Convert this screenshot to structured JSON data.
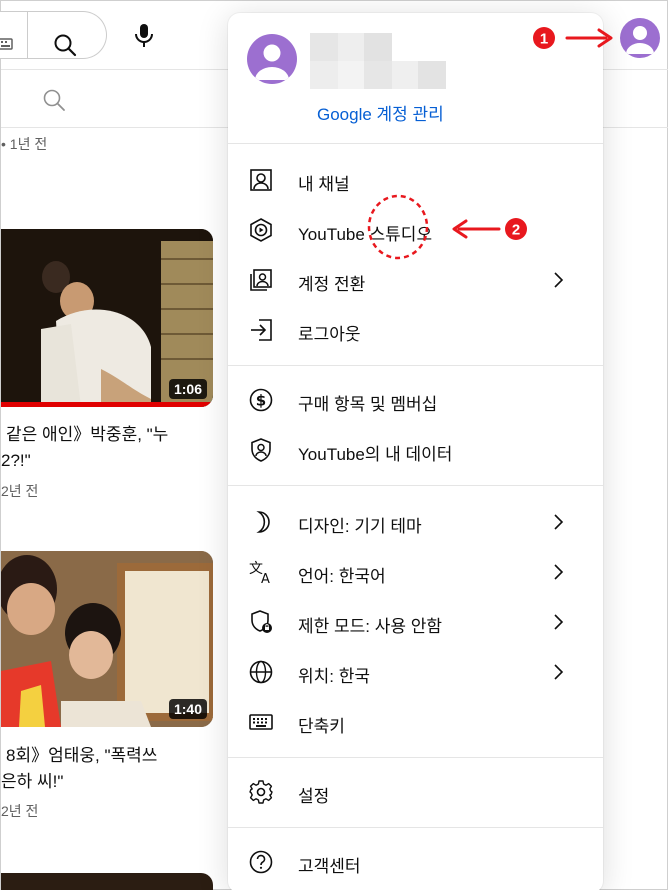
{
  "header": {
    "keyboard_icon": "keyboard-icon",
    "search_icon": "search-icon",
    "mic_icon": "microphone-icon"
  },
  "feed": {
    "top_meta": "• 1년 전",
    "video1": {
      "duration": "1:06",
      "title_line1": "같은 애인》박중훈, \"누",
      "title_line2": "2?!\"",
      "meta": "2년 전"
    },
    "video2": {
      "duration": "1:40",
      "title_line1": "8회》엄태웅, \"폭력쓰",
      "title_line2": "은하 씨!\"",
      "meta": "2년 전"
    }
  },
  "account_menu": {
    "manage_link": "Google 계정 관리",
    "groups": [
      [
        {
          "label": "내 채널",
          "icon": "person-box-icon",
          "chevron": false
        },
        {
          "label": "YouTube 스튜디오",
          "icon": "studio-hexagon-icon",
          "chevron": false
        },
        {
          "label": "계정 전환",
          "icon": "switch-account-icon",
          "chevron": true
        },
        {
          "label": "로그아웃",
          "icon": "sign-out-icon",
          "chevron": false
        }
      ],
      [
        {
          "label": "구매 항목 및 멤버십",
          "icon": "dollar-circle-icon",
          "chevron": false
        },
        {
          "label": "YouTube의 내 데이터",
          "icon": "shield-person-icon",
          "chevron": false
        }
      ],
      [
        {
          "label": "디자인: 기기 테마",
          "icon": "moon-icon",
          "chevron": true
        },
        {
          "label": "언어: 한국어",
          "icon": "translate-icon",
          "chevron": true
        },
        {
          "label": "제한 모드: 사용 안함",
          "icon": "restricted-shield-icon",
          "chevron": true
        },
        {
          "label": "위치: 한국",
          "icon": "globe-icon",
          "chevron": true
        },
        {
          "label": "단축키",
          "icon": "keyboard-icon",
          "chevron": false
        }
      ],
      [
        {
          "label": "설정",
          "icon": "gear-icon",
          "chevron": false
        }
      ],
      [
        {
          "label": "고객센터",
          "icon": "help-circle-icon",
          "chevron": false
        }
      ]
    ]
  },
  "annotations": {
    "marker1": "1",
    "marker2": "2",
    "color": "#e8181e"
  }
}
